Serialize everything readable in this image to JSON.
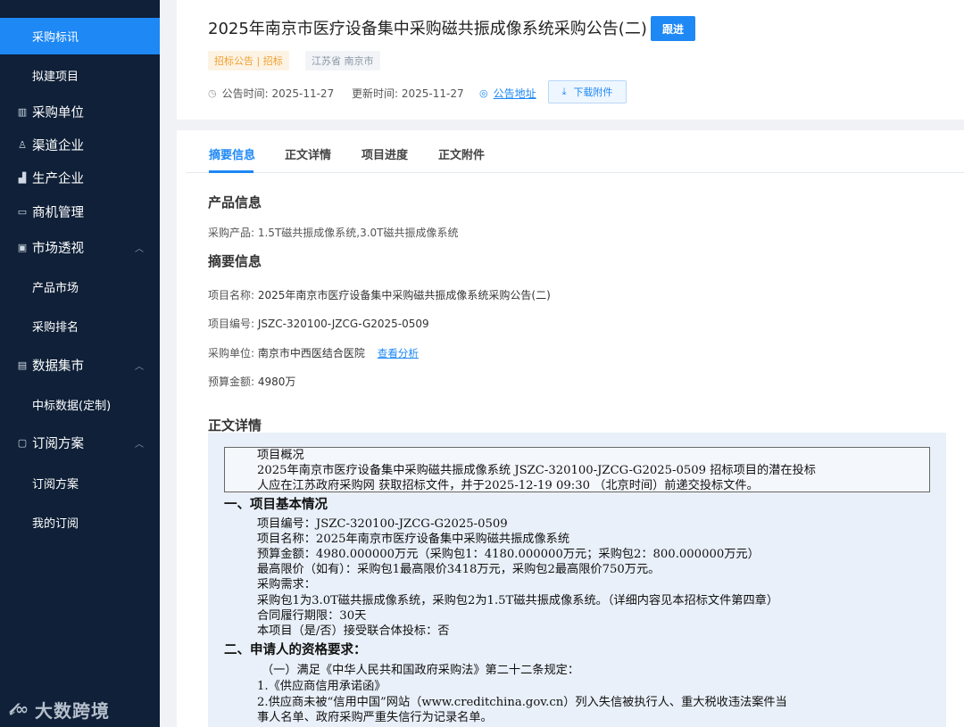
{
  "sidebar": {
    "items": [
      {
        "label": "采购标讯",
        "active": true
      },
      {
        "label": "拟建项目"
      },
      {
        "label": "采购单位",
        "icon": "building-icon"
      },
      {
        "label": "渠道企业",
        "icon": "user-network-icon"
      },
      {
        "label": "生产企业",
        "icon": "factory-icon"
      },
      {
        "label": "商机管理",
        "icon": "briefcase-icon"
      },
      {
        "label": "市场透视",
        "icon": "monitor-icon"
      },
      {
        "label": "产品市场"
      },
      {
        "label": "采购排名"
      },
      {
        "label": "数据集市",
        "icon": "data-icon"
      },
      {
        "label": "中标数据(定制)"
      },
      {
        "label": "订阅方案",
        "icon": "subscribe-icon"
      },
      {
        "label": "订阅方案"
      },
      {
        "label": "我的订阅"
      }
    ],
    "brand": "大数跨境"
  },
  "header": {
    "title": "2025年南京市医疗设备集中采购磁共振成像系统采购公告(二)",
    "follow_label": "跟进",
    "tag_type": "招标公告 | 招标",
    "tag_region": "江苏省 南京市",
    "publish_label": "公告时间: 2025-11-27",
    "update_label": "更新时间: 2025-11-27",
    "address_link": "公告地址",
    "download_label": "下载附件"
  },
  "tabs": [
    "摘要信息",
    "正文详情",
    "项目进度",
    "正文附件"
  ],
  "product": {
    "section_title": "产品信息",
    "line": "采购产品: 1.5T磁共振成像系统,3.0T磁共振成像系统"
  },
  "summary": {
    "section_title": "摘要信息",
    "name_label": "项目名称:",
    "name_value": "2025年南京市医疗设备集中采购磁共振成像系统采购公告(二)",
    "code_label": "项目编号:",
    "code_value": "JSZC-320100-JZCG-G2025-0509",
    "unit_label": "采购单位:",
    "unit_value": "南京市中西医结合医院",
    "unit_link": "查看分析",
    "budget_label": "预算金额:",
    "budget_value": "4980万"
  },
  "detail": {
    "section_title": "正文详情",
    "box_lines": [
      "项目概况",
      "2025年南京市医疗设备集中采购磁共振成像系统 JSZC-320100-JZCG-G2025-0509 招标项目的潜在投标",
      "人应在江苏政府采购网 获取招标文件，并于2025-12-19 09:30 （北京时间）前递交投标文件。"
    ],
    "heading1": "一、项目基本情况",
    "basic_lines": [
      "项目编号：JSZC-320100-JZCG-G2025-0509",
      "项目名称：2025年南京市医疗设备集中采购磁共振成像系统",
      "预算金额：4980.000000万元（采购包1：4180.000000万元；采购包2：800.000000万元）",
      "最高限价（如有）：采购包1最高限价3418万元，采购包2最高限价750万元。",
      "采购需求：",
      "采购包1为3.0T磁共振成像系统，采购包2为1.5T磁共振成像系统。（详细内容见本招标文件第四章）",
      "合同履行期限：30天",
      "本项目（是/否）接受联合体投标：否"
    ],
    "heading2": "二、申请人的资格要求：",
    "qual_lines": [
      "（一）满足《中华人民共和国政府采购法》第二十二条规定：",
      "1.《供应商信用承诺函》",
      "2.供应商未被“信用中国”网站（www.creditchina.gov.cn）列入失信被执行人、重大税收违法案件当",
      "事人名单、政府采购严重失信行为记录名单。"
    ]
  }
}
